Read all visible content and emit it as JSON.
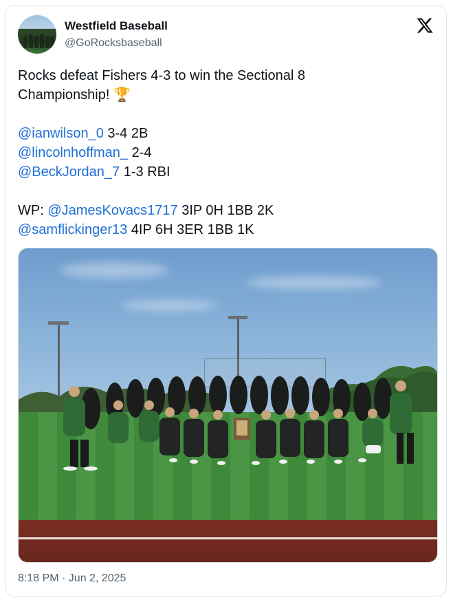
{
  "account": {
    "display_name": "Westfield Baseball",
    "handle": "@GoRocksbaseball"
  },
  "tweet": {
    "line1": "Rocks defeat Fishers 4-3 to win the Sectional 8",
    "line2": "Championship!",
    "trophy_emoji": "🏆",
    "stats": [
      {
        "mention": "@ianwilson_0",
        "text": " 3-4 2B"
      },
      {
        "mention": "@lincolnhoffman_",
        "text": " 2-4"
      },
      {
        "mention": "@BeckJordan_7",
        "text": " 1-3 RBI"
      }
    ],
    "pitching": {
      "prefix": "WP: ",
      "wp_mention": "@JamesKovacs1717",
      "wp_text": " 3IP 0H 1BB 2K",
      "relief_mention": "@samflickinger13",
      "relief_text": " 4IP 6H 3ER 1BB 1K"
    }
  },
  "timestamp": "8:18 PM · Jun 2, 2025",
  "icons": {
    "brand": "x-logo-icon",
    "emoji": "trophy-icon"
  },
  "colors": {
    "mention": "#1d6fd6",
    "secondary_text": "#536471",
    "team_green": "#2f6b34"
  }
}
